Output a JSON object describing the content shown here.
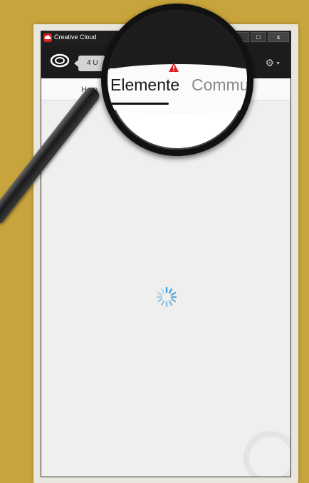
{
  "window": {
    "title": "Creative Cloud",
    "controls": {
      "minimize": "_",
      "maximize": "□",
      "close": "x"
    }
  },
  "appbar": {
    "notification_label": "4 U",
    "settings_icon": "gear-icon"
  },
  "tabs": {
    "visible_label": "Hom"
  },
  "magnifier": {
    "tab_active": "Elemente",
    "tab_next": "Commun",
    "warning_icon": "warning-icon"
  },
  "content": {
    "state_icon": "loading-spinner-icon"
  },
  "colors": {
    "background": "#c8a43c",
    "titlebar": "#1f1f1f",
    "accent_red": "#d7261c",
    "spinner_blue": "#3b9de0"
  }
}
